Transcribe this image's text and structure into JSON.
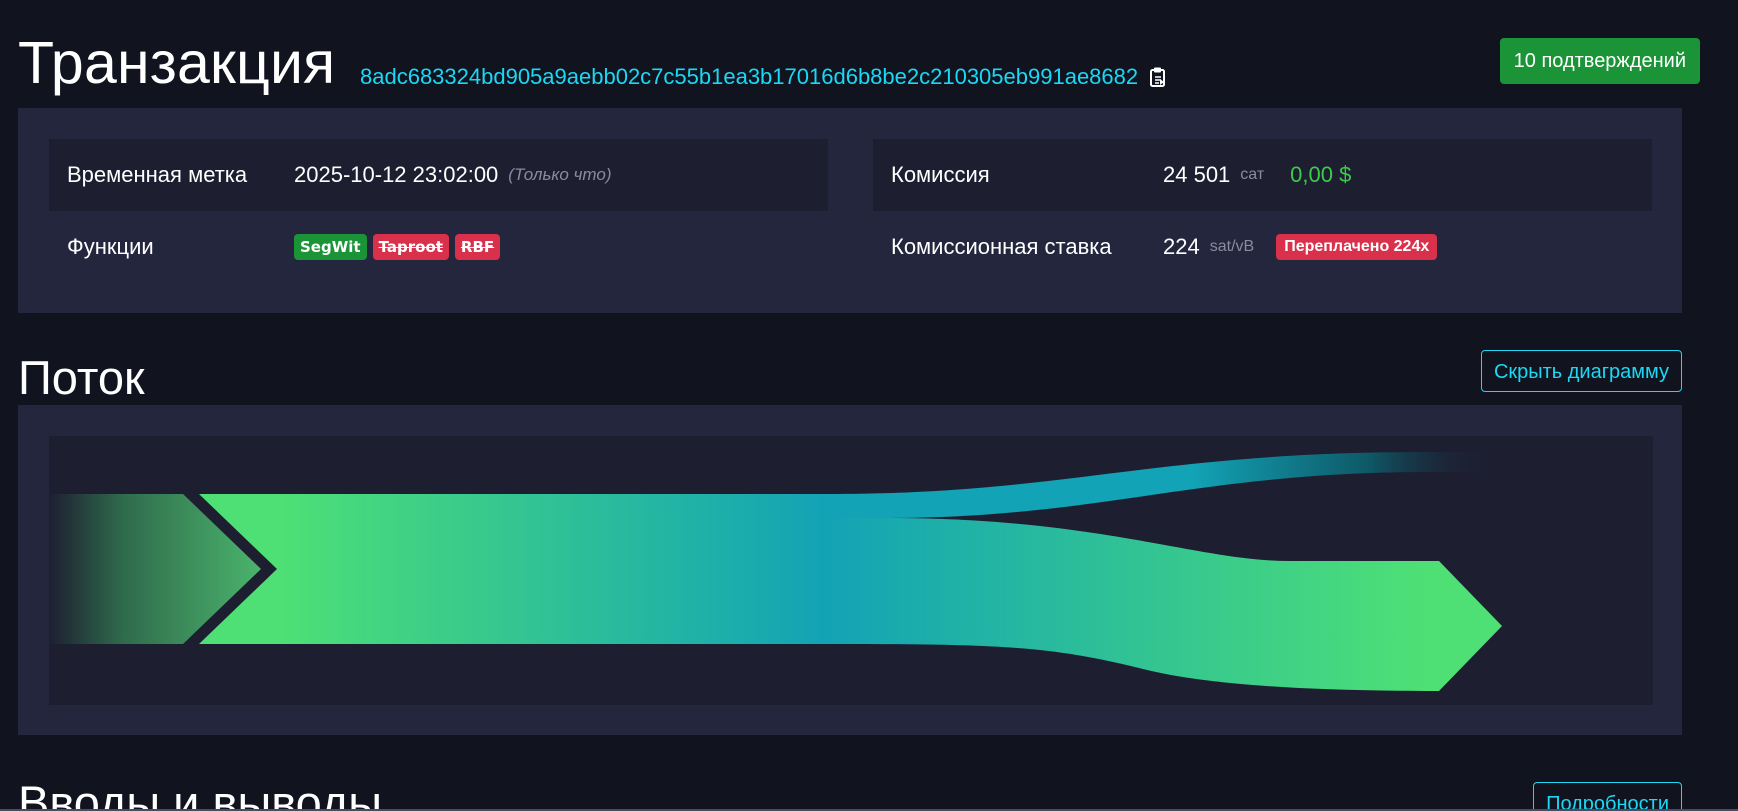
{
  "header": {
    "title": "Транзакция",
    "txid": "8adc683324bd905a9aebb02c7c55b1ea3b17016d6b8be2c210305eb991ae8682",
    "confirmations": "10 подтверждений"
  },
  "details": {
    "timestamp_label": "Временная метка",
    "timestamp_value": "2025-10-12 23:02:00",
    "timestamp_note": "(Только что)",
    "features_label": "Функции",
    "features": [
      {
        "label": "SegWit",
        "status": "on"
      },
      {
        "label": "Taproot",
        "status": "off"
      },
      {
        "label": "RBF",
        "status": "off"
      }
    ],
    "fee_label": "Комиссия",
    "fee_sat": "24 501",
    "fee_unit": "сат",
    "fee_usd": "0,00 $",
    "rate_label": "Комиссионная ставка",
    "rate_value": "224",
    "rate_unit": "sat/vB",
    "overpaid": "Переплачено 224x"
  },
  "flow": {
    "heading": "Поток",
    "toggle_label": "Скрыть диаграмму"
  },
  "io": {
    "heading": "Вводы и выводы",
    "details_label": "Подробности"
  },
  "colors": {
    "accent": "#1bd8f4",
    "success": "#1a9436",
    "danger": "#d9304c",
    "flow_green": "#4ee075",
    "flow_teal": "#11a1b4"
  }
}
